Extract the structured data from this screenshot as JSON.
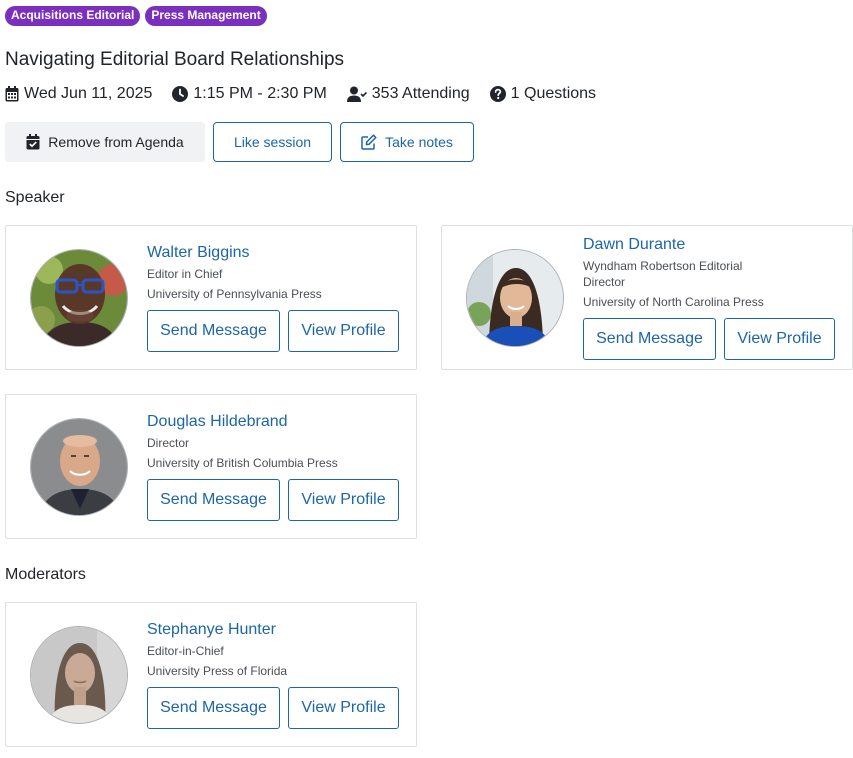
{
  "tags": [
    "Acquisitions Editorial",
    "Press Management"
  ],
  "session": {
    "title": "Navigating Editorial Board Relationships",
    "date": "Wed Jun 11, 2025",
    "time": "1:15 PM - 2:30 PM",
    "attending": "353 Attending",
    "questions": "1 Questions"
  },
  "actions": {
    "agenda": "Remove from Agenda",
    "like": "Like session",
    "notes": "Take notes"
  },
  "sections": {
    "speaker": "Speaker",
    "moderators": "Moderators"
  },
  "buttons": {
    "send": "Send Message",
    "view": "View Profile"
  },
  "speakers": [
    {
      "name": "Walter Biggins",
      "role": "Editor in Chief",
      "org": "University of Pennsylvania Press"
    },
    {
      "name": "Dawn Durante",
      "role": "Wyndham Robertson Editorial Director",
      "org": "University of North Carolina Press"
    },
    {
      "name": "Douglas Hildebrand",
      "role": "Director",
      "org": "University of British Columbia Press"
    }
  ],
  "moderators": [
    {
      "name": "Stephanye Hunter",
      "role": "Editor-in-Chief",
      "org": "University Press of Florida"
    }
  ]
}
